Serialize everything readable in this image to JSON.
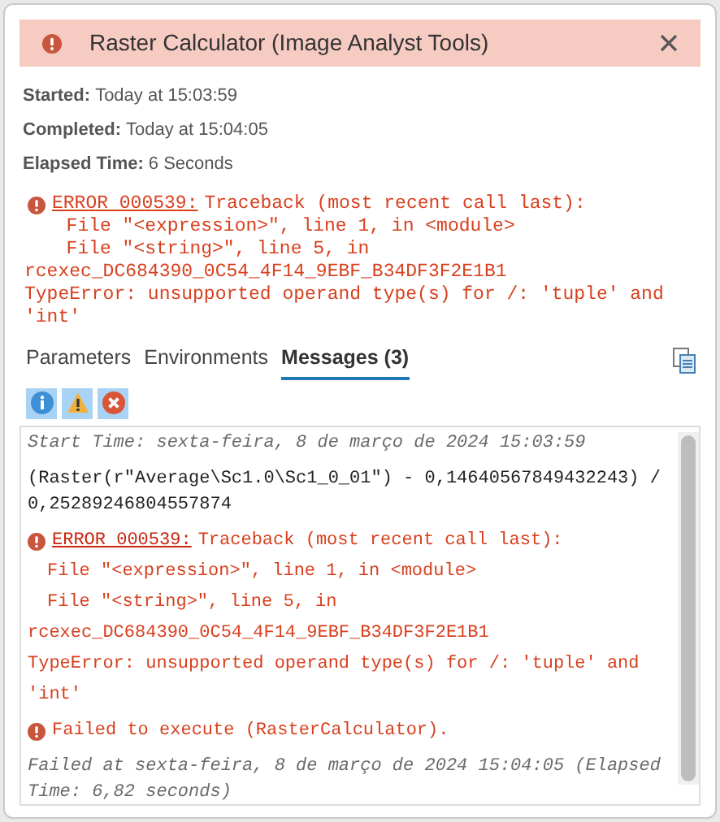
{
  "window": {
    "title": "Raster Calculator (Image Analyst Tools)"
  },
  "summary": [
    {
      "label": "Started:",
      "value": "Today at 15:03:59"
    },
    {
      "label": "Completed:",
      "value": "Today at 15:04:05"
    },
    {
      "label": "Elapsed Time:",
      "value": "6 Seconds"
    }
  ],
  "error": {
    "code": "ERROR 000539:",
    "text": "Traceback (most recent call last):",
    "lines": [
      "  File \"<expression>\", line 1, in <module>",
      "  File \"<string>\", line 5, in",
      "rcexec_DC684390_0C54_4F14_9EBF_B34DF3F2E1B1",
      "TypeError: unsupported operand type(s) for /: 'tuple' and",
      "'int'"
    ]
  },
  "tabs": [
    {
      "label": "Parameters",
      "selected": false
    },
    {
      "label": "Environments",
      "selected": false
    },
    {
      "label": "Messages (3)",
      "selected": true
    }
  ],
  "filters": [
    {
      "kind": "info",
      "selected": true
    },
    {
      "kind": "warning",
      "selected": true
    },
    {
      "kind": "error",
      "selected": true
    }
  ],
  "messages": [
    {
      "kind": "info",
      "lines": [
        "Start Time: sexta-feira, 8 de março de 2024 15:03:59"
      ]
    },
    {
      "kind": "plain",
      "lines": [
        "(Raster(r\"Average\\Sc1.0\\Sc1_0_01\") - 0,14640567849432243) /",
        "0,25289246804557874"
      ]
    },
    {
      "kind": "error",
      "code": "ERROR 000539:",
      "text": "Traceback (most recent call last):",
      "lines": [
        "File \"<expression>\", line 1, in <module>",
        "File \"<string>\", line 5, in",
        "rcexec_DC684390_0C54_4F14_9EBF_B34DF3F2E1B1",
        "TypeError: unsupported operand type(s) for /: 'tuple' and",
        "'int'"
      ]
    },
    {
      "kind": "error",
      "text": "Failed to execute (RasterCalculator)."
    },
    {
      "kind": "info",
      "lines": [
        "Failed at sexta-feira, 8 de março de 2024 15:04:05 (Elapsed",
        "Time: 6,82 seconds)"
      ]
    }
  ]
}
